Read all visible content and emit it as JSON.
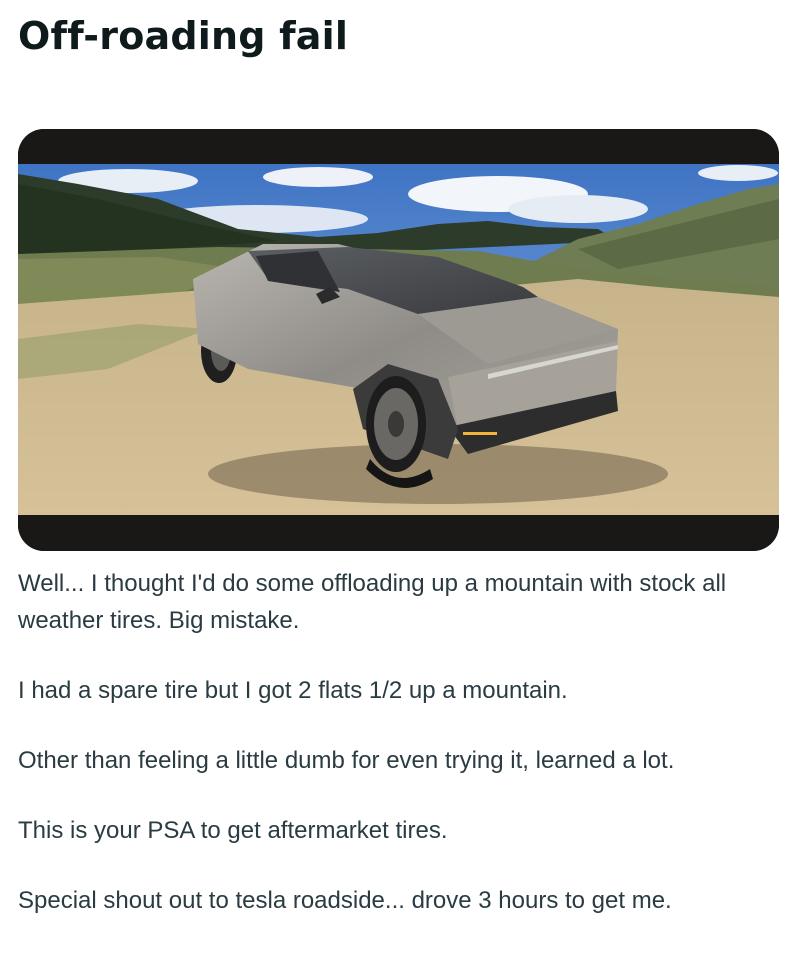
{
  "post": {
    "title": "Off-roading fail",
    "media": {
      "image_alt": "cybertruck-with-flat-tire-on-mountain-dirt-road"
    },
    "paragraphs": [
      "Well... I thought I'd do some offloading up a mountain with stock all weather tires. Big mistake.",
      "I had a spare tire but I got 2 flats 1/2 up a mountain.",
      "Other than feeling a little dumb for even trying it, learned a lot.",
      "This is your PSA to get aftermarket tires.",
      "Special shout out to tesla roadside... drove 3 hours to get me."
    ]
  }
}
